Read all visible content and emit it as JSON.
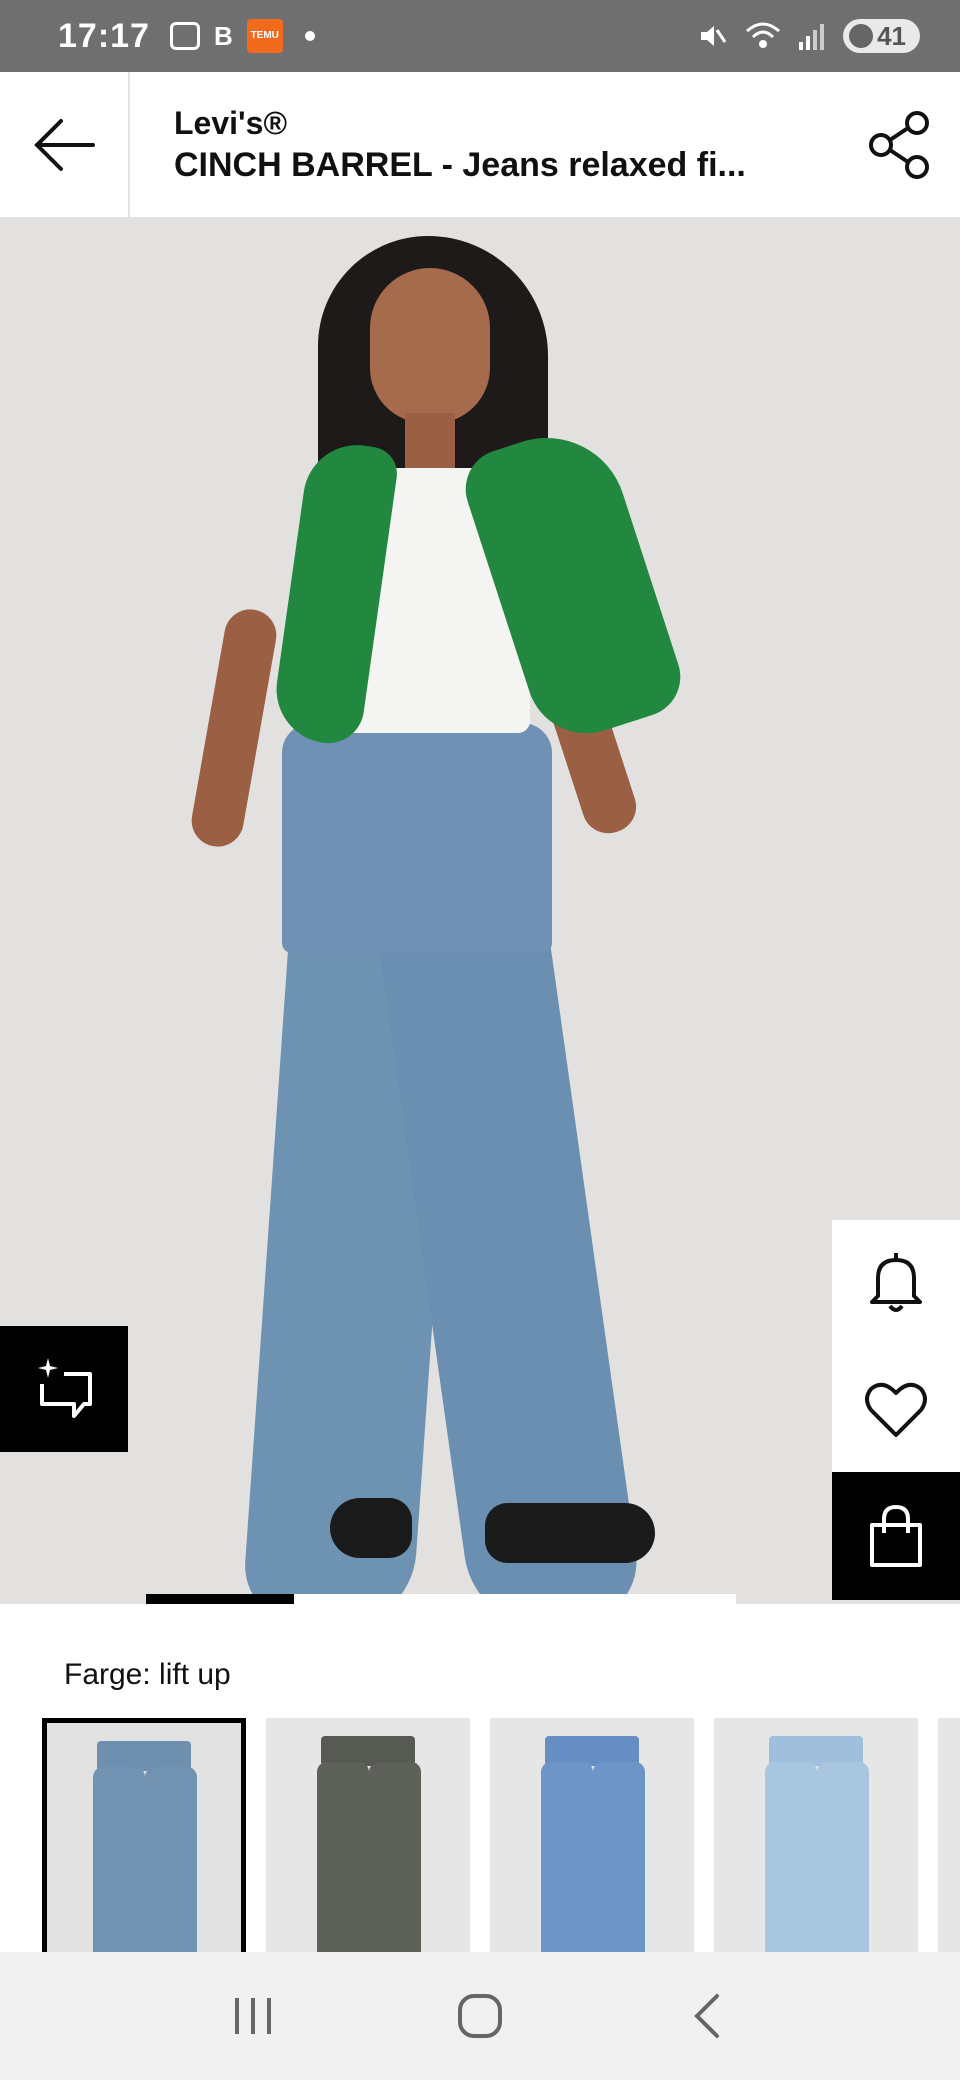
{
  "status_bar": {
    "time": "17:17",
    "b_label": "B",
    "temu_label": "TEMU",
    "battery_level": "41",
    "icons": [
      "screenshot-icon",
      "temu-app-icon",
      "mute-icon",
      "wifi-icon",
      "signal-icon",
      "battery-icon"
    ]
  },
  "header": {
    "back_icon": "arrow-left-icon",
    "brand": "Levi's®",
    "title": "CINCH BARREL - Jeans relaxed fi...",
    "share_icon": "share-icon"
  },
  "hero": {
    "gallery_progress": 0.25,
    "ai_search_icon": "sparkle-crop-icon",
    "actions": [
      {
        "name": "notify",
        "icon": "bell-icon"
      },
      {
        "name": "wishlist",
        "icon": "heart-icon"
      },
      {
        "name": "bag",
        "icon": "shopping-bag-icon"
      }
    ]
  },
  "color": {
    "label": "Farge: lift up",
    "swatches": [
      {
        "name": "lift up",
        "color": "#7393b2",
        "selected": true
      },
      {
        "name": "grey",
        "color": "#5e605a",
        "selected": false
      },
      {
        "name": "mid blue",
        "color": "#6e95c8",
        "selected": false
      },
      {
        "name": "light blue",
        "color": "#a9c6e0",
        "selected": false
      }
    ]
  },
  "nav": {
    "recent": "recent-apps-icon",
    "home": "home-icon",
    "back": "back-icon"
  }
}
